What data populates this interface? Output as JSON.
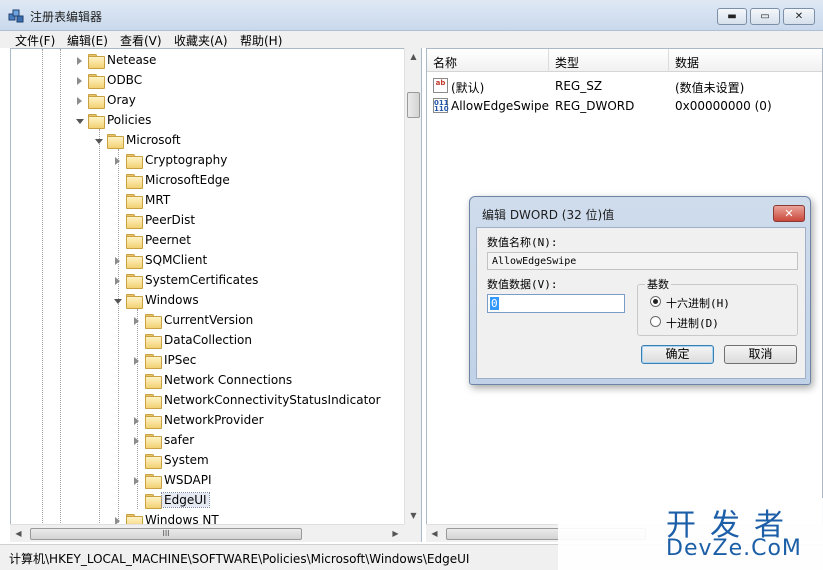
{
  "window": {
    "title": "注册表编辑器",
    "min_glyph": "▬",
    "max_glyph": "▭",
    "close_glyph": "✕",
    "app_icon": "registry-editor-icon"
  },
  "menu": [
    "文件(F)",
    "编辑(E)",
    "查看(V)",
    "收藏夹(A)",
    "帮助(H)"
  ],
  "tree": [
    {
      "label": "Netease",
      "expander": "collapsed"
    },
    {
      "label": "ODBC",
      "expander": "collapsed"
    },
    {
      "label": "Oray",
      "expander": "collapsed"
    },
    {
      "label": "Policies",
      "expander": "open"
    },
    {
      "label": "Microsoft",
      "expander": "open"
    },
    {
      "label": "Cryptography",
      "expander": "collapsed"
    },
    {
      "label": "MicrosoftEdge",
      "expander": "none"
    },
    {
      "label": "MRT",
      "expander": "none"
    },
    {
      "label": "PeerDist",
      "expander": "none"
    },
    {
      "label": "Peernet",
      "expander": "none"
    },
    {
      "label": "SQMClient",
      "expander": "collapsed"
    },
    {
      "label": "SystemCertificates",
      "expander": "collapsed"
    },
    {
      "label": "Windows",
      "expander": "open"
    },
    {
      "label": "CurrentVersion",
      "expander": "collapsed"
    },
    {
      "label": "DataCollection",
      "expander": "none"
    },
    {
      "label": "IPSec",
      "expander": "collapsed"
    },
    {
      "label": "Network Connections",
      "expander": "none"
    },
    {
      "label": "NetworkConnectivityStatusIndicator",
      "expander": "none"
    },
    {
      "label": "NetworkProvider",
      "expander": "collapsed"
    },
    {
      "label": "safer",
      "expander": "collapsed"
    },
    {
      "label": "System",
      "expander": "none"
    },
    {
      "label": "WSDAPI",
      "expander": "collapsed"
    },
    {
      "label": "EdgeUI",
      "expander": "none",
      "selected": true
    },
    {
      "label": "Windows NT",
      "expander": "collapsed"
    }
  ],
  "scrollbar": {
    "up": "▲",
    "down": "▼",
    "left": "◀",
    "right": "▶",
    "grip": "III"
  },
  "list": {
    "columns": [
      "名称",
      "类型",
      "数据"
    ],
    "rows": [
      {
        "icon": "string-value-icon",
        "icon_text": "ab",
        "name": "(默认)",
        "type": "REG_SZ",
        "data": "(数值未设置)"
      },
      {
        "icon": "dword-value-icon",
        "icon_text": "011\n110",
        "name": "AllowEdgeSwipe",
        "type": "REG_DWORD",
        "data": "0x00000000 (0)"
      }
    ]
  },
  "status": {
    "path": "计算机\\HKEY_LOCAL_MACHINE\\SOFTWARE\\Policies\\Microsoft\\Windows\\EdgeUI"
  },
  "watermark": {
    "cn": "开发者",
    "en": "DevZe.CoM"
  },
  "dialog": {
    "title": "编辑 DWORD (32 位)值",
    "close_glyph": "✕",
    "name_label": "数值名称(N):",
    "name_value": "AllowEdgeSwipe",
    "data_label": "数值数据(V):",
    "data_value": "0",
    "base_label": "基数",
    "hex_label": "十六进制(H)",
    "dec_label": "十进制(D)",
    "selected_base": "hex",
    "ok_label": "确定",
    "cancel_label": "取消"
  }
}
